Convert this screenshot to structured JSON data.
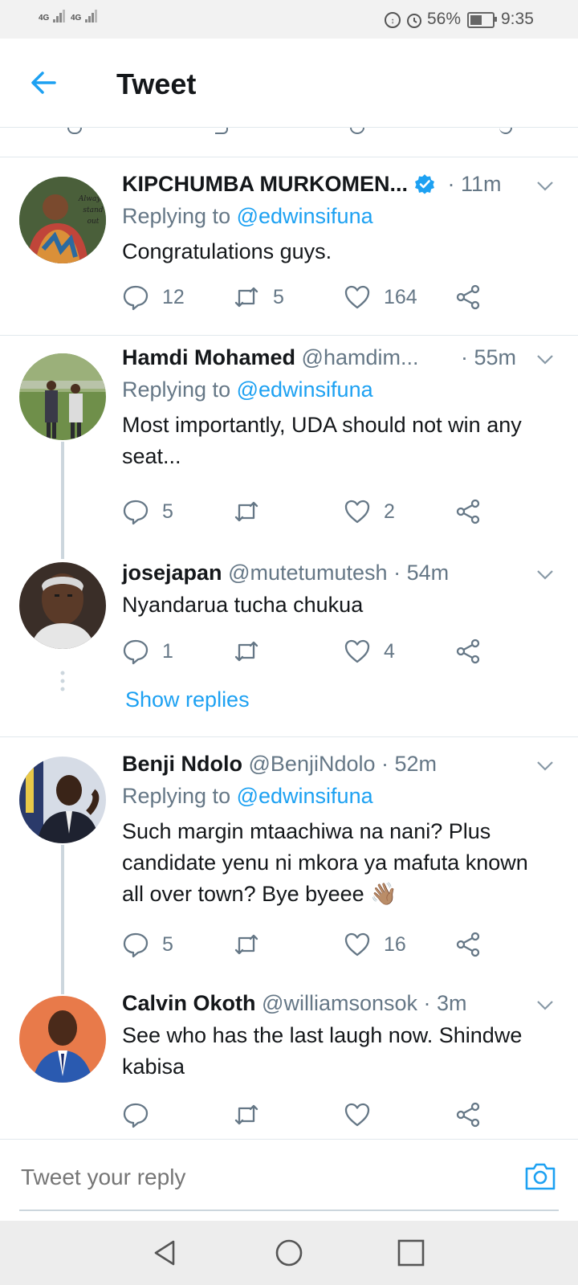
{
  "status_bar": {
    "signal1": "4G",
    "signal2": "4G",
    "battery": "56%",
    "time": "9:35"
  },
  "header": {
    "title": "Tweet"
  },
  "tweets": [
    {
      "name": "KIPCHUMBA MURKOMEN...",
      "handle": "",
      "time": "· 11m",
      "verified": true,
      "replying_prefix": "Replying to ",
      "replying_to": "@edwinsifuna",
      "text": "Congratulations guys.",
      "replies": "12",
      "retweets": "5",
      "likes": "164"
    },
    {
      "name": "Hamdi Mohamed",
      "handle": "@hamdim...",
      "time": "· 55m",
      "replying_prefix": "Replying to ",
      "replying_to": "@edwinsifuna",
      "text": "Most importantly, UDA should not win any seat...",
      "replies": "5",
      "retweets": "",
      "likes": "2"
    },
    {
      "name": "josejapan",
      "handle": "@mutetumutesh",
      "time": "· 54m",
      "text": "Nyandarua tucha chukua",
      "replies": "1",
      "retweets": "",
      "likes": "4",
      "show_replies": "Show replies"
    },
    {
      "name": "Benji Ndolo",
      "handle": "@BenjiNdolo",
      "time": "· 52m",
      "replying_prefix": "Replying to ",
      "replying_to": "@edwinsifuna",
      "text": "Such margin mtaachiwa na nani? Plus candidate yenu ni mkora ya mafuta known all over town? Bye byeee 👋🏽",
      "replies": "5",
      "retweets": "",
      "likes": "16"
    },
    {
      "name": "Calvin Okoth",
      "handle": "@williamsonsok",
      "time": "· 3m",
      "text": "See who has the last laugh now. Shindwe kabisa",
      "replies": "",
      "retweets": "",
      "likes": ""
    }
  ],
  "reply_bar": {
    "placeholder": "Tweet your reply"
  },
  "colors": {
    "accent": "#1da1f2",
    "muted": "#657786",
    "divider": "#e1e8ed"
  }
}
